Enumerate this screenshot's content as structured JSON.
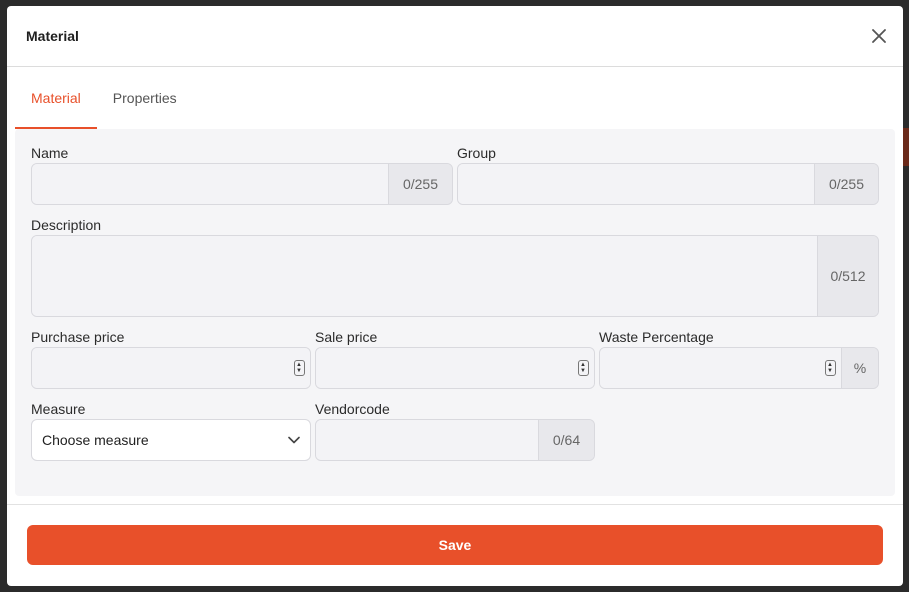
{
  "modal": {
    "title": "Material"
  },
  "tabs": [
    {
      "label": "Material",
      "active": true
    },
    {
      "label": "Properties",
      "active": false
    }
  ],
  "form": {
    "name": {
      "label": "Name",
      "value": "",
      "counter": "0/255"
    },
    "group": {
      "label": "Group",
      "value": "",
      "counter": "0/255"
    },
    "description": {
      "label": "Description",
      "value": "",
      "counter": "0/512"
    },
    "purchase_price": {
      "label": "Purchase price",
      "value": ""
    },
    "sale_price": {
      "label": "Sale price",
      "value": ""
    },
    "waste_percentage": {
      "label": "Waste Percentage",
      "value": "",
      "unit": "%"
    },
    "measure": {
      "label": "Measure",
      "selected": "Choose measure"
    },
    "vendorcode": {
      "label": "Vendorcode",
      "value": "",
      "counter": "0/64"
    }
  },
  "footer": {
    "save_label": "Save"
  },
  "colors": {
    "accent": "#e8502a",
    "panel_bg": "#f5f5f7"
  }
}
